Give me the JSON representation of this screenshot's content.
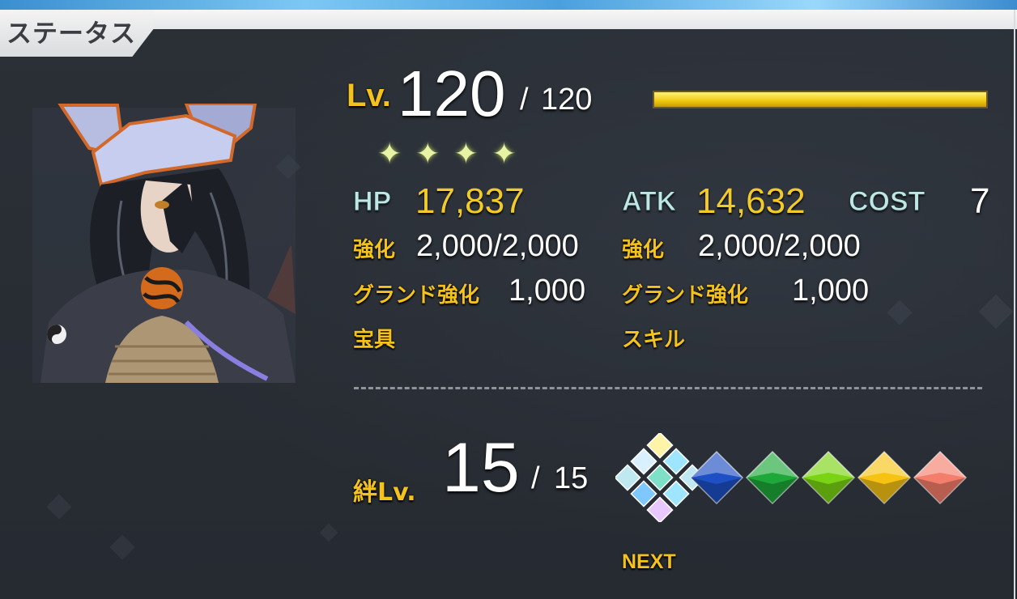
{
  "header": {
    "title": "ステータス"
  },
  "level": {
    "prefix": "Lv.",
    "current": "120",
    "separator": "/",
    "max": "120",
    "progress": 1.0
  },
  "stars": {
    "count": 4,
    "glyph": "✦"
  },
  "stats": {
    "hp_label": "HP",
    "hp_value": "17,837",
    "atk_label": "ATK",
    "atk_value": "14,632",
    "cost_label": "COST",
    "cost_value": "7",
    "hp_enhance_label": "強化",
    "hp_enhance_value": "2,000/2,000",
    "atk_enhance_label": "強化",
    "atk_enhance_value": "2,000/2,000",
    "hp_grand_label": "グランド強化",
    "hp_grand_value": "1,000",
    "atk_grand_label": "グランド強化",
    "atk_grand_value": "1,000",
    "np_label": "宝具",
    "skill_label": "スキル"
  },
  "bond": {
    "label": "絆Lv.",
    "current": "15",
    "separator": "/",
    "max": "15",
    "next_label": "NEXT",
    "gems": [
      {
        "name": "prism",
        "color": "#bfe8f0"
      },
      {
        "name": "blue",
        "color": "#1e4fc4"
      },
      {
        "name": "green",
        "color": "#1ea83a"
      },
      {
        "name": "lime",
        "color": "#7ad414"
      },
      {
        "name": "yellow",
        "color": "#f6c313"
      },
      {
        "name": "pink",
        "color": "#f47e6c"
      }
    ]
  },
  "colors": {
    "accent_gold": "#f2cb2a",
    "bar_gold": "#f7d41a",
    "panel": "#272c33"
  }
}
